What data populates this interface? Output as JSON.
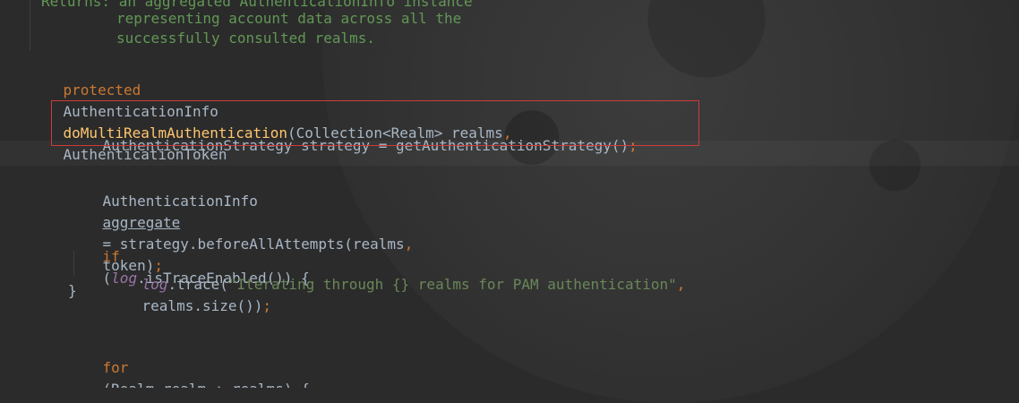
{
  "doc": {
    "line1": "Returns: an aggregated AuthenticationInfo instance",
    "line2": "representing account data across all the",
    "line3": "successfully consulted realms."
  },
  "signature": {
    "modifier": "protected",
    "return_type": "AuthenticationInfo",
    "method_name": "doMultiRealmAuthentication",
    "params": "(Collection<Realm> realms",
    "comma": ",",
    "params_rest": "AuthenticationToken"
  },
  "line_strategy": {
    "text": "AuthenticationStrategy strategy = getAuthenticationStrategy()",
    "semicolon": ";"
  },
  "line_aggregate": {
    "type": "AuthenticationInfo",
    "var": "aggregate",
    "rest": "= strategy.beforeAllAttempts(realms",
    "comma": ",",
    "rest2": "token)",
    "semicolon": ";"
  },
  "line_if": {
    "kw": "if",
    "open": "(",
    "field": "log",
    "rest": ".isTraceEnabled()) {"
  },
  "line_trace": {
    "field": "log",
    "call": ".trace(",
    "string": "\"Iterating through {} realms for PAM authentication\"",
    "comma": ",",
    "rest": "realms.size())",
    "semicolon": ";"
  },
  "line_close": {
    "brace": "}"
  },
  "line_for": {
    "kw": "for",
    "rest": "(Realm realm : realms) {"
  }
}
